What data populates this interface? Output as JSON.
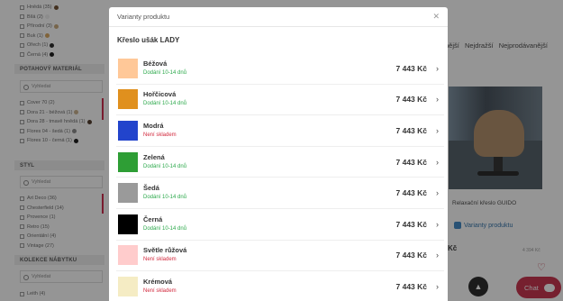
{
  "background": {
    "filters": {
      "colour_options": [
        {
          "label": "Hnědá (35)",
          "color": "#6b4a2a"
        },
        {
          "label": "Bílá (2)",
          "color": "#eeeeee"
        },
        {
          "label": "Přírodní (3)",
          "color": "#c8a878"
        },
        {
          "label": "Buk (1)",
          "color": "#d9a55a"
        },
        {
          "label": "Ořech (1)",
          "color": "#222222"
        },
        {
          "label": "Černá (4)",
          "color": "#111111"
        }
      ],
      "upholstery_heading": "Potahový materiál",
      "upholstery_search_placeholder": "Vyhledat",
      "upholstery_options": [
        {
          "label": "Cover 70 (2)",
          "color": ""
        },
        {
          "label": "Dora 21 - béžová (1)",
          "color": "#c9b08a"
        },
        {
          "label": "Dora 28 - tmavě hnědá (1)",
          "color": "#4a3324"
        },
        {
          "label": "Flores 04 - šedá (1)",
          "color": "#888888"
        },
        {
          "label": "Flores 10 - černá (1)",
          "color": "#111111"
        }
      ],
      "style_heading": "Styl",
      "style_search_placeholder": "Vyhledat",
      "style_options": [
        {
          "label": "Art Deco (36)"
        },
        {
          "label": "Chesterfield (14)"
        },
        {
          "label": "Provence (1)"
        },
        {
          "label": "Retro (15)"
        },
        {
          "label": "Orientální (4)"
        },
        {
          "label": "Vintage (27)"
        }
      ],
      "collection_heading": "Kolekce nábytku",
      "collection_search_placeholder": "Vyhledat",
      "collection_options": [
        {
          "label": "Leith (4)"
        }
      ]
    },
    "sort_links": [
      "nější",
      "Nejdražší",
      "Nejprodávanější"
    ],
    "product_card": {
      "name": "Relaxační křeslo GUIDO",
      "variant_link": "Varianty produktu",
      "price": "Kč",
      "old_price": "4 394 Kč"
    },
    "scroll_top_icon": "arrow-up-icon",
    "chat_label": "Chat"
  },
  "modal": {
    "title": "Varianty produktu",
    "close_icon": "close-icon",
    "product_title": "Křeslo ušák LADY",
    "variants": [
      {
        "name": "Béžová",
        "status": "Dodání 10-14 dnů",
        "price": "7 443 Kč",
        "swatch": "#ffc898",
        "status_color": "#2aa84a"
      },
      {
        "name": "Hořčicová",
        "status": "Dodání 10-14 dnů",
        "price": "7 443 Kč",
        "swatch": "#e0901e",
        "status_color": "#2aa84a"
      },
      {
        "name": "Modrá",
        "status": "Není skladem",
        "price": "7 443 Kč",
        "swatch": "#2244cc",
        "status_color": "#d22a3e"
      },
      {
        "name": "Zelená",
        "status": "Dodání 10-14 dnů",
        "price": "7 443 Kč",
        "swatch": "#2e9e35",
        "status_color": "#2aa84a"
      },
      {
        "name": "Šedá",
        "status": "Dodání 10-14 dnů",
        "price": "7 443 Kč",
        "swatch": "#9a9a9a",
        "status_color": "#2aa84a"
      },
      {
        "name": "Černá",
        "status": "Dodání 10-14 dnů",
        "price": "7 443 Kč",
        "swatch": "#000000",
        "status_color": "#2aa84a"
      },
      {
        "name": "Světle růžová",
        "status": "Není skladem",
        "price": "7 443 Kč",
        "swatch": "#ffcccc",
        "status_color": "#d22a3e"
      },
      {
        "name": "Krémová",
        "status": "Není skladem",
        "price": "7 443 Kč",
        "swatch": "#f5ecc4",
        "status_color": "#d22a3e"
      }
    ]
  }
}
